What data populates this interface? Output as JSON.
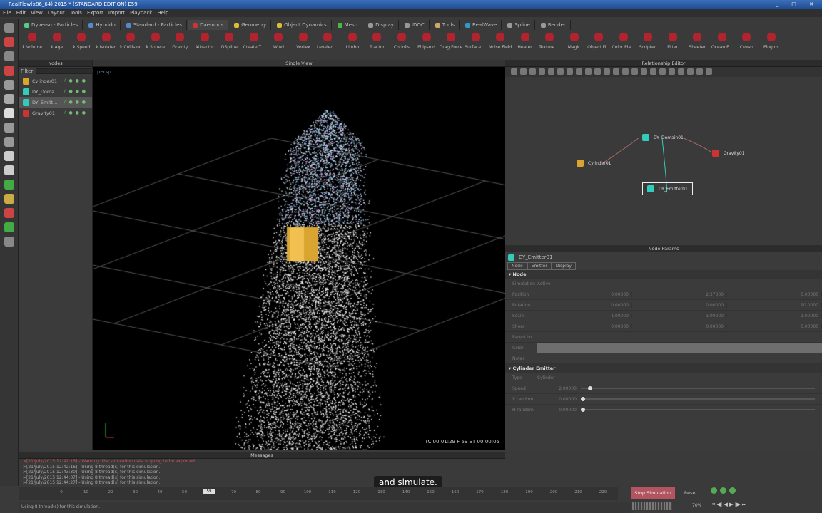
{
  "window": {
    "title": "RealFlow(x86_64) 2015 * (STANDARD EDITION) E59",
    "controls": "_ □ ✕"
  },
  "menu": [
    "File",
    "Edit",
    "View",
    "Layout",
    "Tools",
    "Export",
    "Import",
    "Playback",
    "Help"
  ],
  "shelf_tabs": [
    {
      "label": "Dyverso - Particles",
      "color": "#5c8"
    },
    {
      "label": "Hybrido",
      "color": "#58c"
    },
    {
      "label": "Standard - Particles",
      "color": "#58c"
    },
    {
      "label": "Daemons",
      "color": "#c33",
      "active": true
    },
    {
      "label": "Geometry",
      "color": "#db3"
    },
    {
      "label": "Object Dynamics",
      "color": "#db3"
    },
    {
      "label": "Mesh",
      "color": "#4b4"
    },
    {
      "label": "Display",
      "color": "#999"
    },
    {
      "label": "IDOC",
      "color": "#999"
    },
    {
      "label": "Tools",
      "color": "#ca6"
    },
    {
      "label": "RealWave",
      "color": "#39c"
    },
    {
      "label": "Spline",
      "color": "#999"
    },
    {
      "label": "Render",
      "color": "#999"
    }
  ],
  "shelf_icons": [
    "k Volume",
    "k Age",
    "k Speed",
    "k Isolated",
    "k Collision",
    "k Sphere",
    "Gravity",
    "Attractor",
    "DSpline",
    "Create T...",
    "Wind",
    "Vortex",
    "Leveled ...",
    "Limbo",
    "Tractor",
    "Coriolis",
    "Ellipsoid",
    "Drag Force",
    "Surface ...",
    "Noise Field",
    "Heater",
    "Texture ...",
    "Magic",
    "Object Fi...",
    "Color Pla...",
    "Scripted",
    "Filter",
    "Sheeter",
    "Ocean F...",
    "Crown",
    "Plugins"
  ],
  "nodes": {
    "title": "Nodes",
    "filter_label": "Filter",
    "items": [
      {
        "name": "Cylinder01",
        "color": "#d9a430"
      },
      {
        "name": "DY_Doma...",
        "color": "#3cb"
      },
      {
        "name": "DY_Emitt...",
        "color": "#3cb",
        "selected": true
      },
      {
        "name": "Gravity01",
        "color": "#c33"
      }
    ]
  },
  "viewport": {
    "title": "Single View",
    "camera": "persp",
    "hud": "TC 00:01:29   F 59   ST 00:00:05"
  },
  "relationship_editor": {
    "title": "Relationship Editor",
    "nodes": [
      {
        "name": "DY_Domain01",
        "color": "#3cb"
      },
      {
        "name": "Gravity01",
        "color": "#c33"
      },
      {
        "name": "Cylinder01",
        "color": "#d9a430"
      },
      {
        "name": "DY_Emitter01",
        "color": "#3cb"
      }
    ]
  },
  "node_params": {
    "title": "Node Params",
    "node_name": "DY_Emitter01",
    "tabs": [
      "Node",
      "Emitter",
      "Display"
    ],
    "node_section": "Node",
    "simulation": {
      "label": "Simulation",
      "value": "Active"
    },
    "vectors": [
      {
        "label": "Position",
        "values": [
          "0.00000",
          "2.37300",
          "0.00000"
        ]
      },
      {
        "label": "Rotation",
        "values": [
          "0.00000",
          "0.00000",
          "90.0000"
        ]
      },
      {
        "label": "Scale",
        "values": [
          "1.00000",
          "1.00000",
          "1.00000"
        ]
      },
      {
        "label": "Shear",
        "values": [
          "0.00000",
          "0.00000",
          "0.00000"
        ]
      }
    ],
    "parent_to": "Parent to",
    "color_label": "Color",
    "color_value": "#6e6e6e",
    "notes_label": "Notes",
    "emitter_section": "Cylinder Emitter",
    "type": {
      "label": "Type",
      "value": "Cylinder"
    },
    "sliders": [
      {
        "label": "Speed",
        "value": "2.00000",
        "fraction": 0.03
      },
      {
        "label": "V random",
        "value": "0.00000",
        "fraction": 0
      },
      {
        "label": "H random",
        "value": "0.00000",
        "fraction": 0
      }
    ]
  },
  "messages": {
    "title": "Messages",
    "lines": [
      {
        "text": ">[21/July/2015 12:42:16] - Warning: the simulation data is going to be exported.",
        "err": true
      },
      {
        "text": ">[21/July/2015 12:42:16] - Using 8 thread(s) for this simulation."
      },
      {
        "text": ">[21/July/2015 12:43:30] - Using 8 thread(s) for this simulation."
      },
      {
        "text": ">[21/July/2015 12:44:07] - Using 8 thread(s) for this simulation."
      },
      {
        "text": ">[21/July/2015 12:44:27] - Using 8 thread(s) for this simulation."
      }
    ]
  },
  "caption": "and simulate.",
  "timeline": {
    "ticks": [
      "0",
      "10",
      "20",
      "30",
      "40",
      "50",
      "59",
      "70",
      "80",
      "90",
      "100",
      "110",
      "120",
      "130",
      "140",
      "150",
      "160",
      "170",
      "180",
      "190",
      "200",
      "210",
      "220"
    ],
    "current": "59"
  },
  "status": "Using 8 thread(s) for this simulation.",
  "sim": {
    "stop": "Stop Simulation",
    "reset": "Reset",
    "percent": "70%",
    "playback": "⏮ ◀| ◀ ▶ |▶ ⏭"
  }
}
